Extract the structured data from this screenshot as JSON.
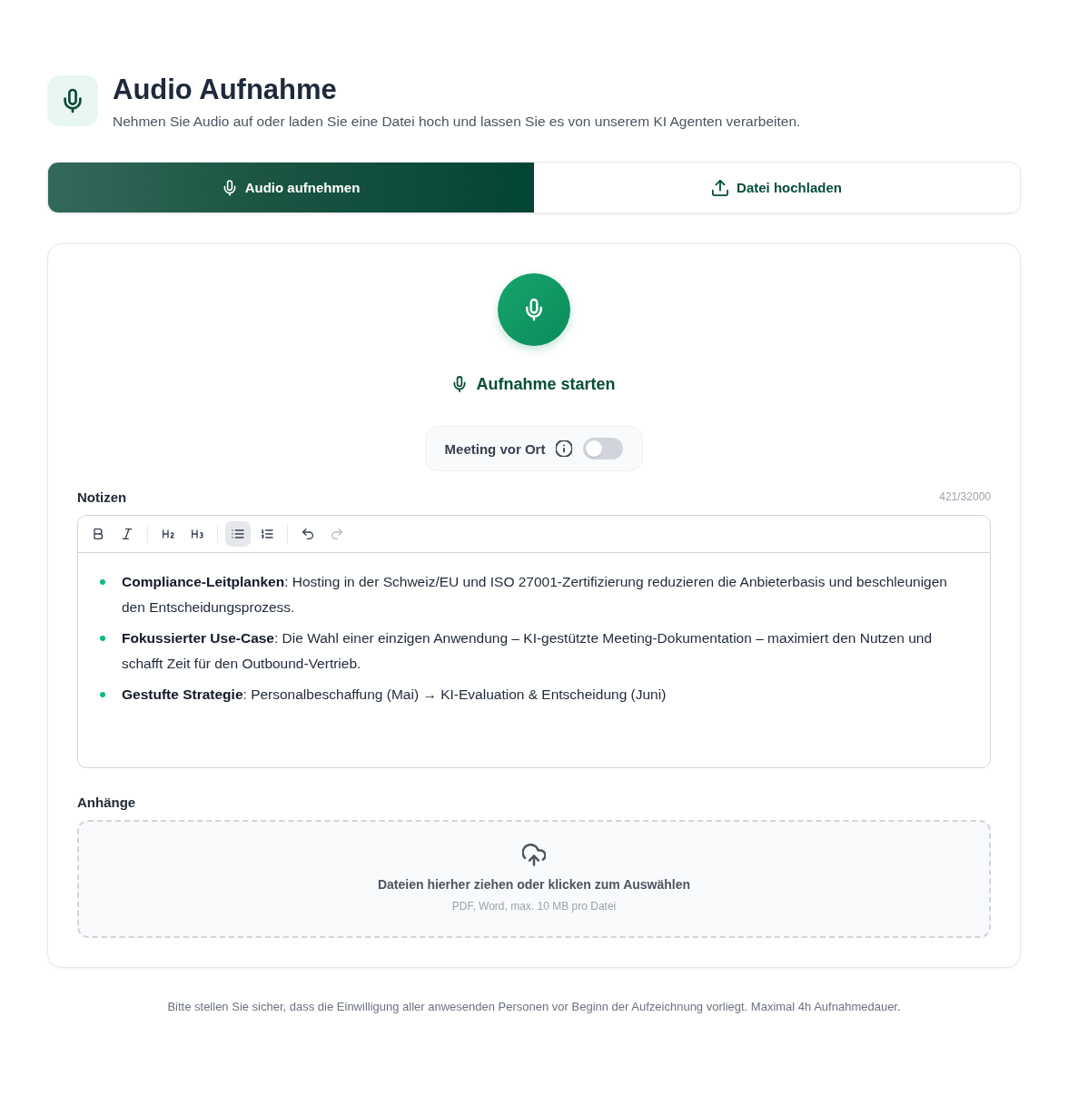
{
  "header": {
    "title": "Audio Aufnahme",
    "subtitle": "Nehmen Sie Audio auf oder laden Sie eine Datei hoch und lassen Sie es von unserem KI Agenten verarbeiten."
  },
  "tabs": [
    {
      "kind": "record",
      "label": "Audio aufnehmen",
      "selected": true
    },
    {
      "kind": "upload",
      "label": "Datei hochladen",
      "selected": false
    }
  ],
  "recorder": {
    "button_label": "Aufnahme starten",
    "meeting_toggle": {
      "label": "Meeting vor Ort",
      "on": false
    }
  },
  "notes": {
    "label": "Notizen",
    "counter": "421/32000",
    "toolbar_groups": [
      {
        "buttons": [
          {
            "kind": "bold",
            "active": false,
            "disabled": false
          },
          {
            "kind": "italic",
            "active": false,
            "disabled": false
          }
        ]
      },
      {
        "buttons": [
          {
            "kind": "heading-2",
            "active": false,
            "disabled": false
          },
          {
            "kind": "heading-3",
            "active": false,
            "disabled": false
          }
        ]
      },
      {
        "buttons": [
          {
            "kind": "bullet-list",
            "active": true,
            "disabled": false
          },
          {
            "kind": "numbered-list",
            "active": false,
            "disabled": false
          }
        ]
      },
      {
        "buttons": [
          {
            "kind": "undo",
            "active": false,
            "disabled": false
          },
          {
            "kind": "redo",
            "active": false,
            "disabled": true
          }
        ]
      }
    ],
    "items": [
      "**Compliance-Leitplanken**: Hosting in der Schweiz/EU und ISO 27001-Zertifizierung reduzieren die Anbieterbasis und beschleunigen den Entscheidungsprozess.",
      "**Fokussierter Use-Case**: Die Wahl einer einzigen Anwendung – KI-gestützte Meeting-Dokumentation – maximiert den Nutzen und schafft Zeit für den Outbound-Vertrieb.",
      "**Gestufte Strategie**: Personalbeschaffung (Mai) → KI-Evaluation & Entscheidung (Juni)"
    ]
  },
  "attachments": {
    "label": "Anhänge",
    "dropzone_text": "Dateien hierher ziehen oder klicken zum Auswählen",
    "hint": "PDF, Word, max. 10 MB pro Datei"
  },
  "footer": "Bitte stellen Sie sicher, dass die Einwilligung aller anwesenden Personen vor Beginn der Aufzeichnung vorliegt. Maximal 4h Aufnahmedauer."
}
